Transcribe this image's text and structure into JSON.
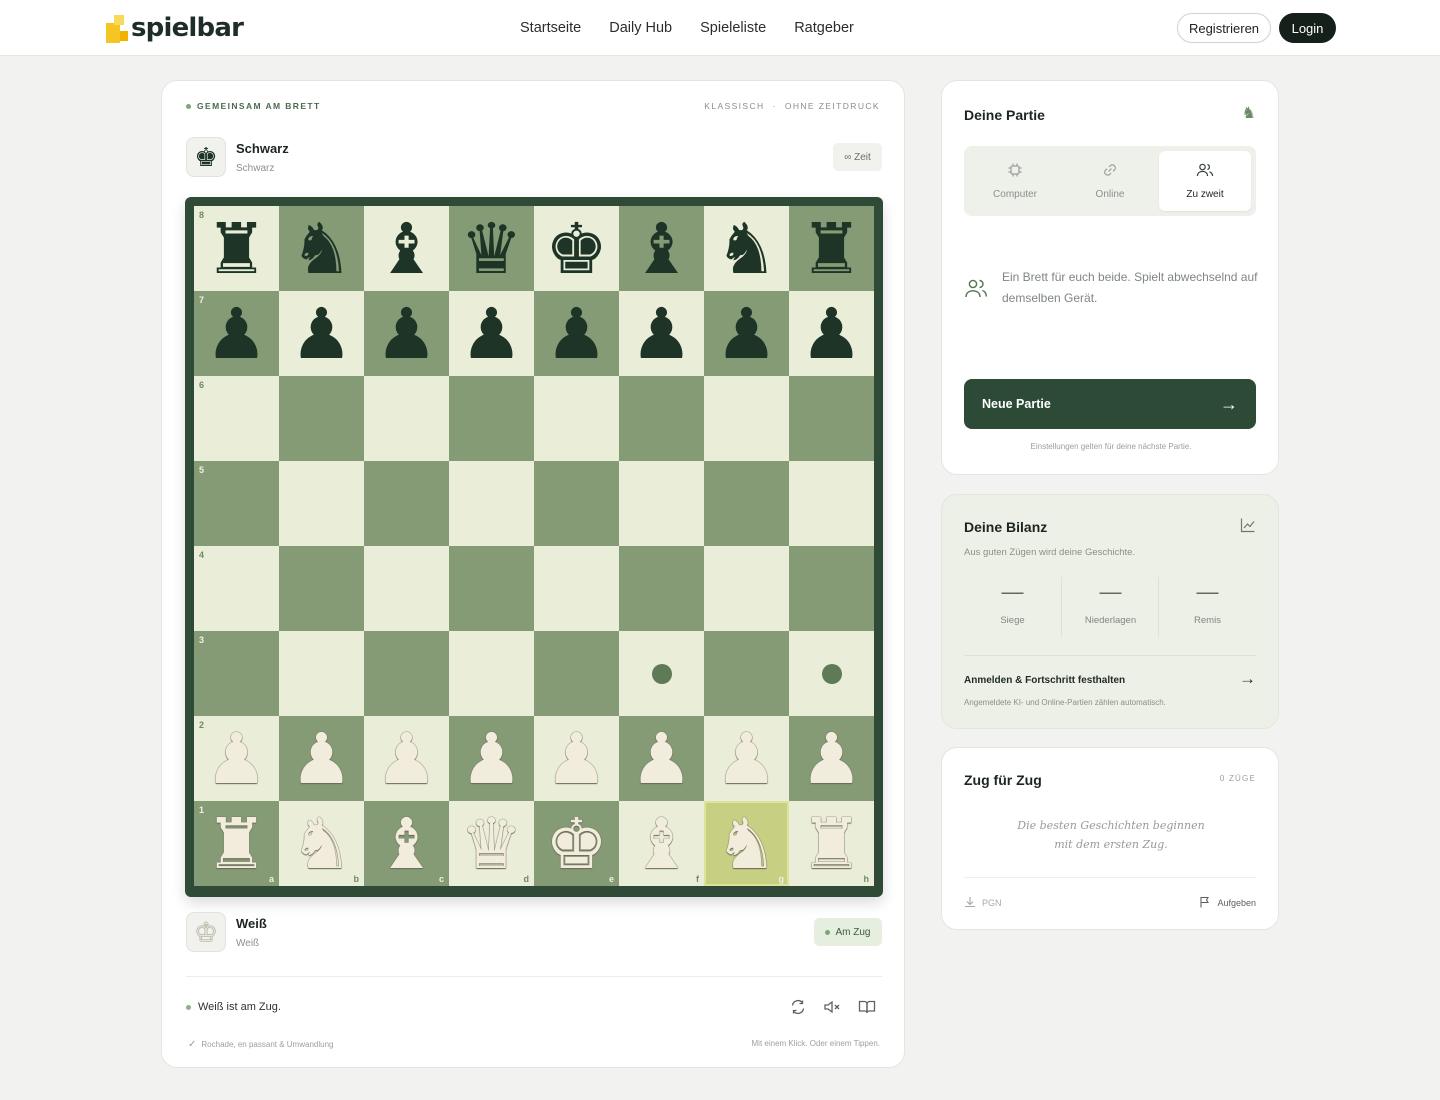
{
  "brand": {
    "name": "spielbar",
    "colors": {
      "accent": "#f5c623",
      "dark": "#16201b",
      "board_light": "#eaeed9",
      "board_dark": "#849b76",
      "primary": "#2d4a37"
    }
  },
  "nav": {
    "items": [
      "Startseite",
      "Daily Hub",
      "Spieleliste",
      "Ratgeber"
    ]
  },
  "auth": {
    "register": "Registrieren",
    "login": "Login"
  },
  "game": {
    "mode_label": "GEMEINSAM AM BRETT",
    "variant": "KLASSISCH",
    "separator": "·",
    "time_mode": "OHNE ZEITDRUCK",
    "black": {
      "name": "Schwarz",
      "sub": "Schwarz",
      "time_pill": "∞ Zeit",
      "avatar_icon": "black-king-icon"
    },
    "white": {
      "name": "Weiß",
      "sub": "Weiß",
      "turn_pill": "Am Zug",
      "avatar_icon": "white-king-icon"
    },
    "status": "Weiß ist am Zug.",
    "footer_left": "Rochade, en passant & Umwandlung",
    "footer_right": "Mit einem Klick. Oder einem Tippen.",
    "controls": [
      "flip-board-icon",
      "sound-off-icon",
      "book-icon"
    ],
    "board": {
      "ranks": [
        "8",
        "7",
        "6",
        "5",
        "4",
        "3",
        "2",
        "1"
      ],
      "files": [
        "a",
        "b",
        "c",
        "d",
        "e",
        "f",
        "g",
        "h"
      ],
      "position": [
        [
          "r",
          "n",
          "b",
          "q",
          "k",
          "b",
          "n",
          "r"
        ],
        [
          "p",
          "p",
          "p",
          "p",
          "p",
          "p",
          "p",
          "p"
        ],
        [
          "",
          "",
          "",
          "",
          "",
          "",
          "",
          ""
        ],
        [
          "",
          "",
          "",
          "",
          "",
          "",
          "",
          ""
        ],
        [
          "",
          "",
          "",
          "",
          "",
          "",
          "",
          ""
        ],
        [
          "",
          "",
          "",
          "",
          "",
          "",
          "",
          ""
        ],
        [
          "P",
          "P",
          "P",
          "P",
          "P",
          "P",
          "P",
          "P"
        ],
        [
          "R",
          "N",
          "B",
          "Q",
          "K",
          "B",
          "N",
          "R"
        ]
      ],
      "selected": "g1",
      "move_hints": [
        "f3",
        "h3"
      ]
    }
  },
  "partie": {
    "title": "Deine Partie",
    "tabs": [
      {
        "label": "Computer",
        "icon": "chip-icon",
        "active": false
      },
      {
        "label": "Online",
        "icon": "link-icon",
        "active": false
      },
      {
        "label": "Zu zweit",
        "icon": "users-icon",
        "active": true
      }
    ],
    "description": "Ein Brett für euch beide. Spielt abwechselnd auf demselben Gerät.",
    "new_game": "Neue Partie",
    "note": "Einstellungen gelten für deine nächste Partie."
  },
  "bilanz": {
    "title": "Deine Bilanz",
    "subtitle": "Aus guten Zügen wird deine Geschichte.",
    "stats": [
      {
        "value": "—",
        "label": "Siege"
      },
      {
        "value": "—",
        "label": "Niederlagen"
      },
      {
        "value": "—",
        "label": "Remis"
      }
    ],
    "link": "Anmelden & Fortschritt festhalten",
    "link_sub": "Angemeldete KI- und Online-Partien zählen automatisch."
  },
  "moves": {
    "title": "Zug für Zug",
    "count": "0 ZÜGE",
    "empty_line1": "Die besten Geschichten beginnen",
    "empty_line2": "mit dem ersten Zug.",
    "pgn": "PGN",
    "resign": "Aufgeben"
  }
}
